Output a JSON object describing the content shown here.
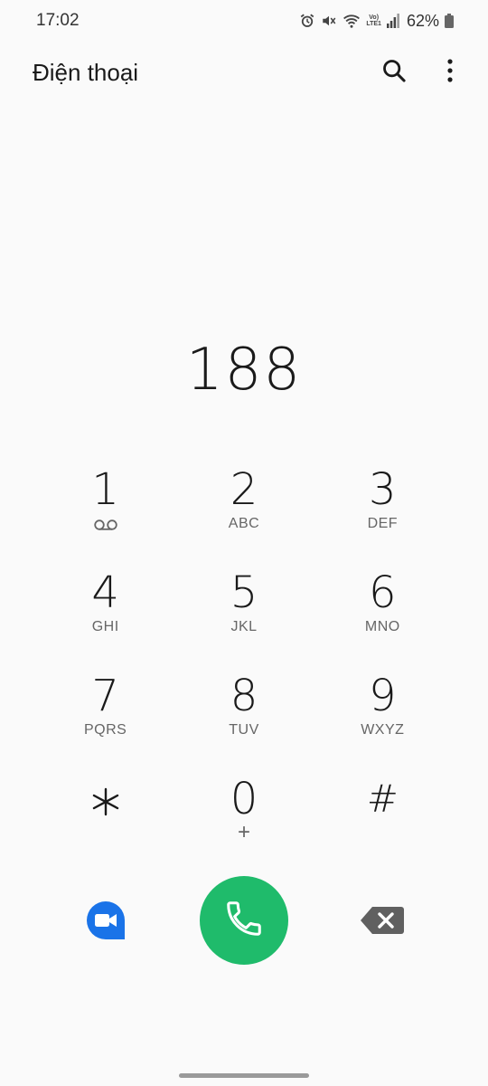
{
  "status_bar": {
    "time": "17:02",
    "network_top": "Vo)",
    "network_bottom": "LTE1",
    "battery": "62%"
  },
  "app_bar": {
    "title": "Điện thoại",
    "search_icon": "search-icon",
    "more_icon": "more-vert-icon"
  },
  "number": "188",
  "keypad": [
    {
      "digit": "1",
      "letters": "",
      "sub_icon": "voicemail-icon"
    },
    {
      "digit": "2",
      "letters": "ABC"
    },
    {
      "digit": "3",
      "letters": "DEF"
    },
    {
      "digit": "4",
      "letters": "GHI"
    },
    {
      "digit": "5",
      "letters": "JKL"
    },
    {
      "digit": "6",
      "letters": "MNO"
    },
    {
      "digit": "7",
      "letters": "PQRS"
    },
    {
      "digit": "8",
      "letters": "TUV"
    },
    {
      "digit": "9",
      "letters": "WXYZ"
    },
    {
      "digit": "*",
      "letters": "",
      "sub_icon": "asterisk-icon"
    },
    {
      "digit": "0",
      "letters": "+"
    },
    {
      "digit": "#",
      "letters": ""
    }
  ],
  "actions": {
    "video_icon": "video-call-icon",
    "call_icon": "phone-icon",
    "backspace_icon": "backspace-icon"
  },
  "colors": {
    "call_green": "#1fbb6b",
    "video_blue": "#1a73e8",
    "background": "#fafafa"
  }
}
